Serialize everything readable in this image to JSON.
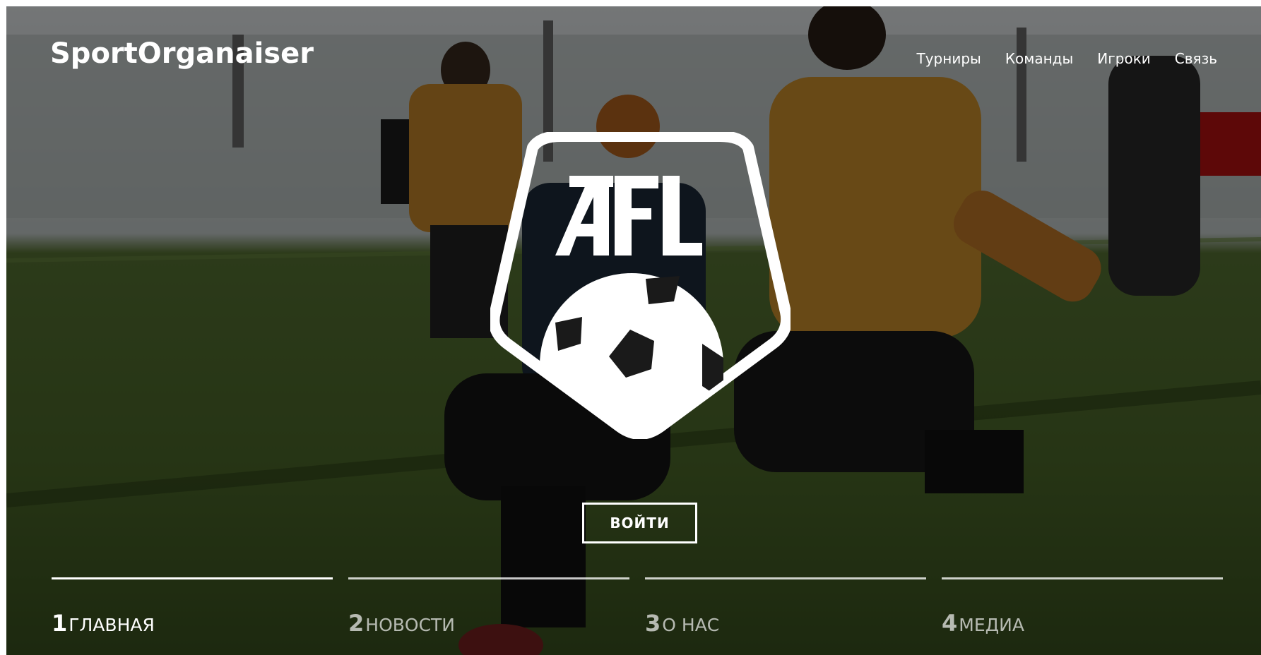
{
  "brand": {
    "name": "SportOrganaiser"
  },
  "nav": {
    "items": [
      {
        "label": "Турниры"
      },
      {
        "label": "Команды"
      },
      {
        "label": "Игроки"
      },
      {
        "label": "Связь"
      }
    ]
  },
  "hero": {
    "logo_text": "AFL",
    "login_button": "ВОЙТИ"
  },
  "slides": [
    {
      "number": "1",
      "label": "ГЛАВНАЯ",
      "active": true
    },
    {
      "number": "2",
      "label": "НОВОСТИ",
      "active": false
    },
    {
      "number": "3",
      "label": "О НАС",
      "active": false
    },
    {
      "number": "4",
      "label": "МЕДИА",
      "active": false
    }
  ],
  "colors": {
    "text": "#ffffff",
    "shirt_orange": "#c8892a",
    "field_green": "#3e5a25"
  }
}
